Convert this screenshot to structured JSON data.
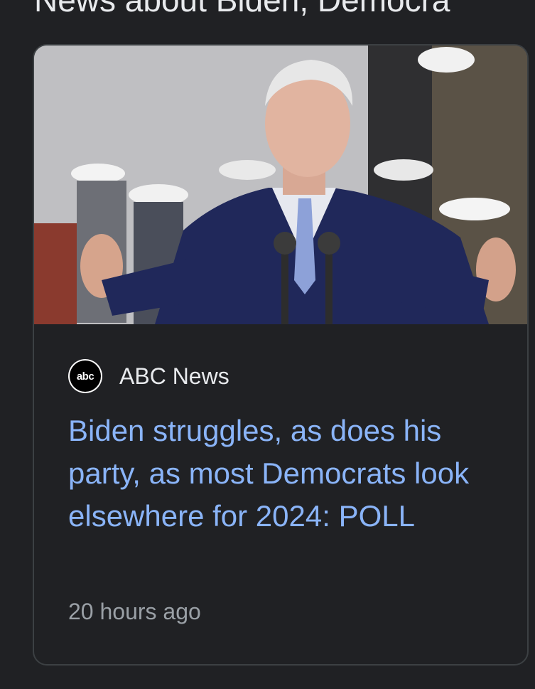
{
  "section": {
    "heading": "News about Biden, Democra"
  },
  "card": {
    "image_alt": "Joe Biden speaking at a podium",
    "source": {
      "logo_text": "abc",
      "name": "ABC News"
    },
    "headline": "Biden struggles, as does his party, as most Democrats look elsewhere for 2024: POLL",
    "timestamp": "20 hours ago"
  },
  "colors": {
    "background": "#202124",
    "headline_link": "#8ab4f8",
    "secondary_text": "#9aa0a6",
    "card_border": "#3c4043"
  }
}
